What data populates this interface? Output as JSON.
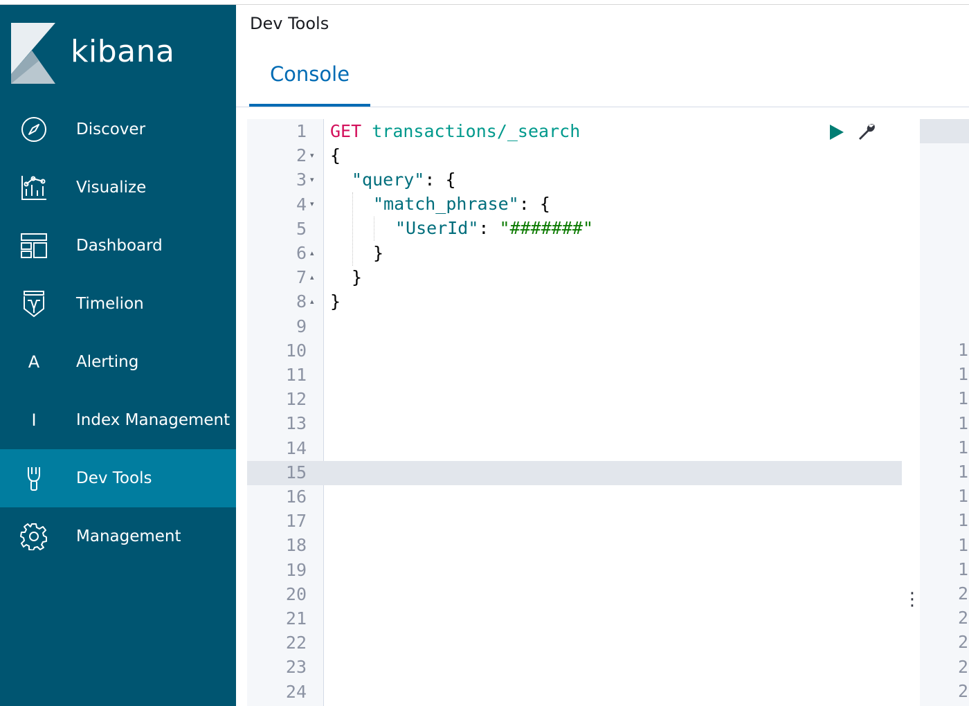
{
  "app": {
    "brand": "kibana"
  },
  "sidebar": {
    "items": [
      {
        "label": "Discover",
        "icon": "compass-icon"
      },
      {
        "label": "Visualize",
        "icon": "visualize-icon"
      },
      {
        "label": "Dashboard",
        "icon": "dashboard-icon"
      },
      {
        "label": "Timelion",
        "icon": "timelion-icon"
      },
      {
        "label": "Alerting",
        "icon": "letter-a-icon",
        "letter": "A"
      },
      {
        "label": "Index Management",
        "icon": "letter-i-icon",
        "letter": "I"
      },
      {
        "label": "Dev Tools",
        "icon": "devtools-icon",
        "active": true
      },
      {
        "label": "Management",
        "icon": "gear-icon"
      }
    ]
  },
  "header": {
    "title": "Dev Tools",
    "tab": "Console"
  },
  "editor": {
    "method": "GET",
    "path": "transactions/_search",
    "code": {
      "l2": "{",
      "l3_key": "\"query\"",
      "l3_rest": ": {",
      "l4_key": "\"match_phrase\"",
      "l4_rest": ": {",
      "l5_key": "\"UserId\"",
      "l5_sep": ": ",
      "l5_val": "\"#######\"",
      "l6": "}",
      "l7": "}",
      "l8": "}"
    },
    "line_numbers": [
      "1",
      "2",
      "3",
      "4",
      "5",
      "6",
      "7",
      "8",
      "9",
      "10",
      "11",
      "12",
      "13",
      "14",
      "15",
      "16",
      "17",
      "18",
      "19",
      "20",
      "21",
      "22",
      "23",
      "24"
    ],
    "active_line": 15,
    "accent_color": "#006bb4",
    "sidebar_color": "#005571",
    "sidebar_active_color": "#017d9f"
  },
  "output": {
    "line_numbers": [
      "1",
      "1",
      "1",
      "1",
      "1",
      "1",
      "1",
      "1",
      "1",
      "1",
      "2",
      "2",
      "2",
      "2",
      "2"
    ]
  }
}
